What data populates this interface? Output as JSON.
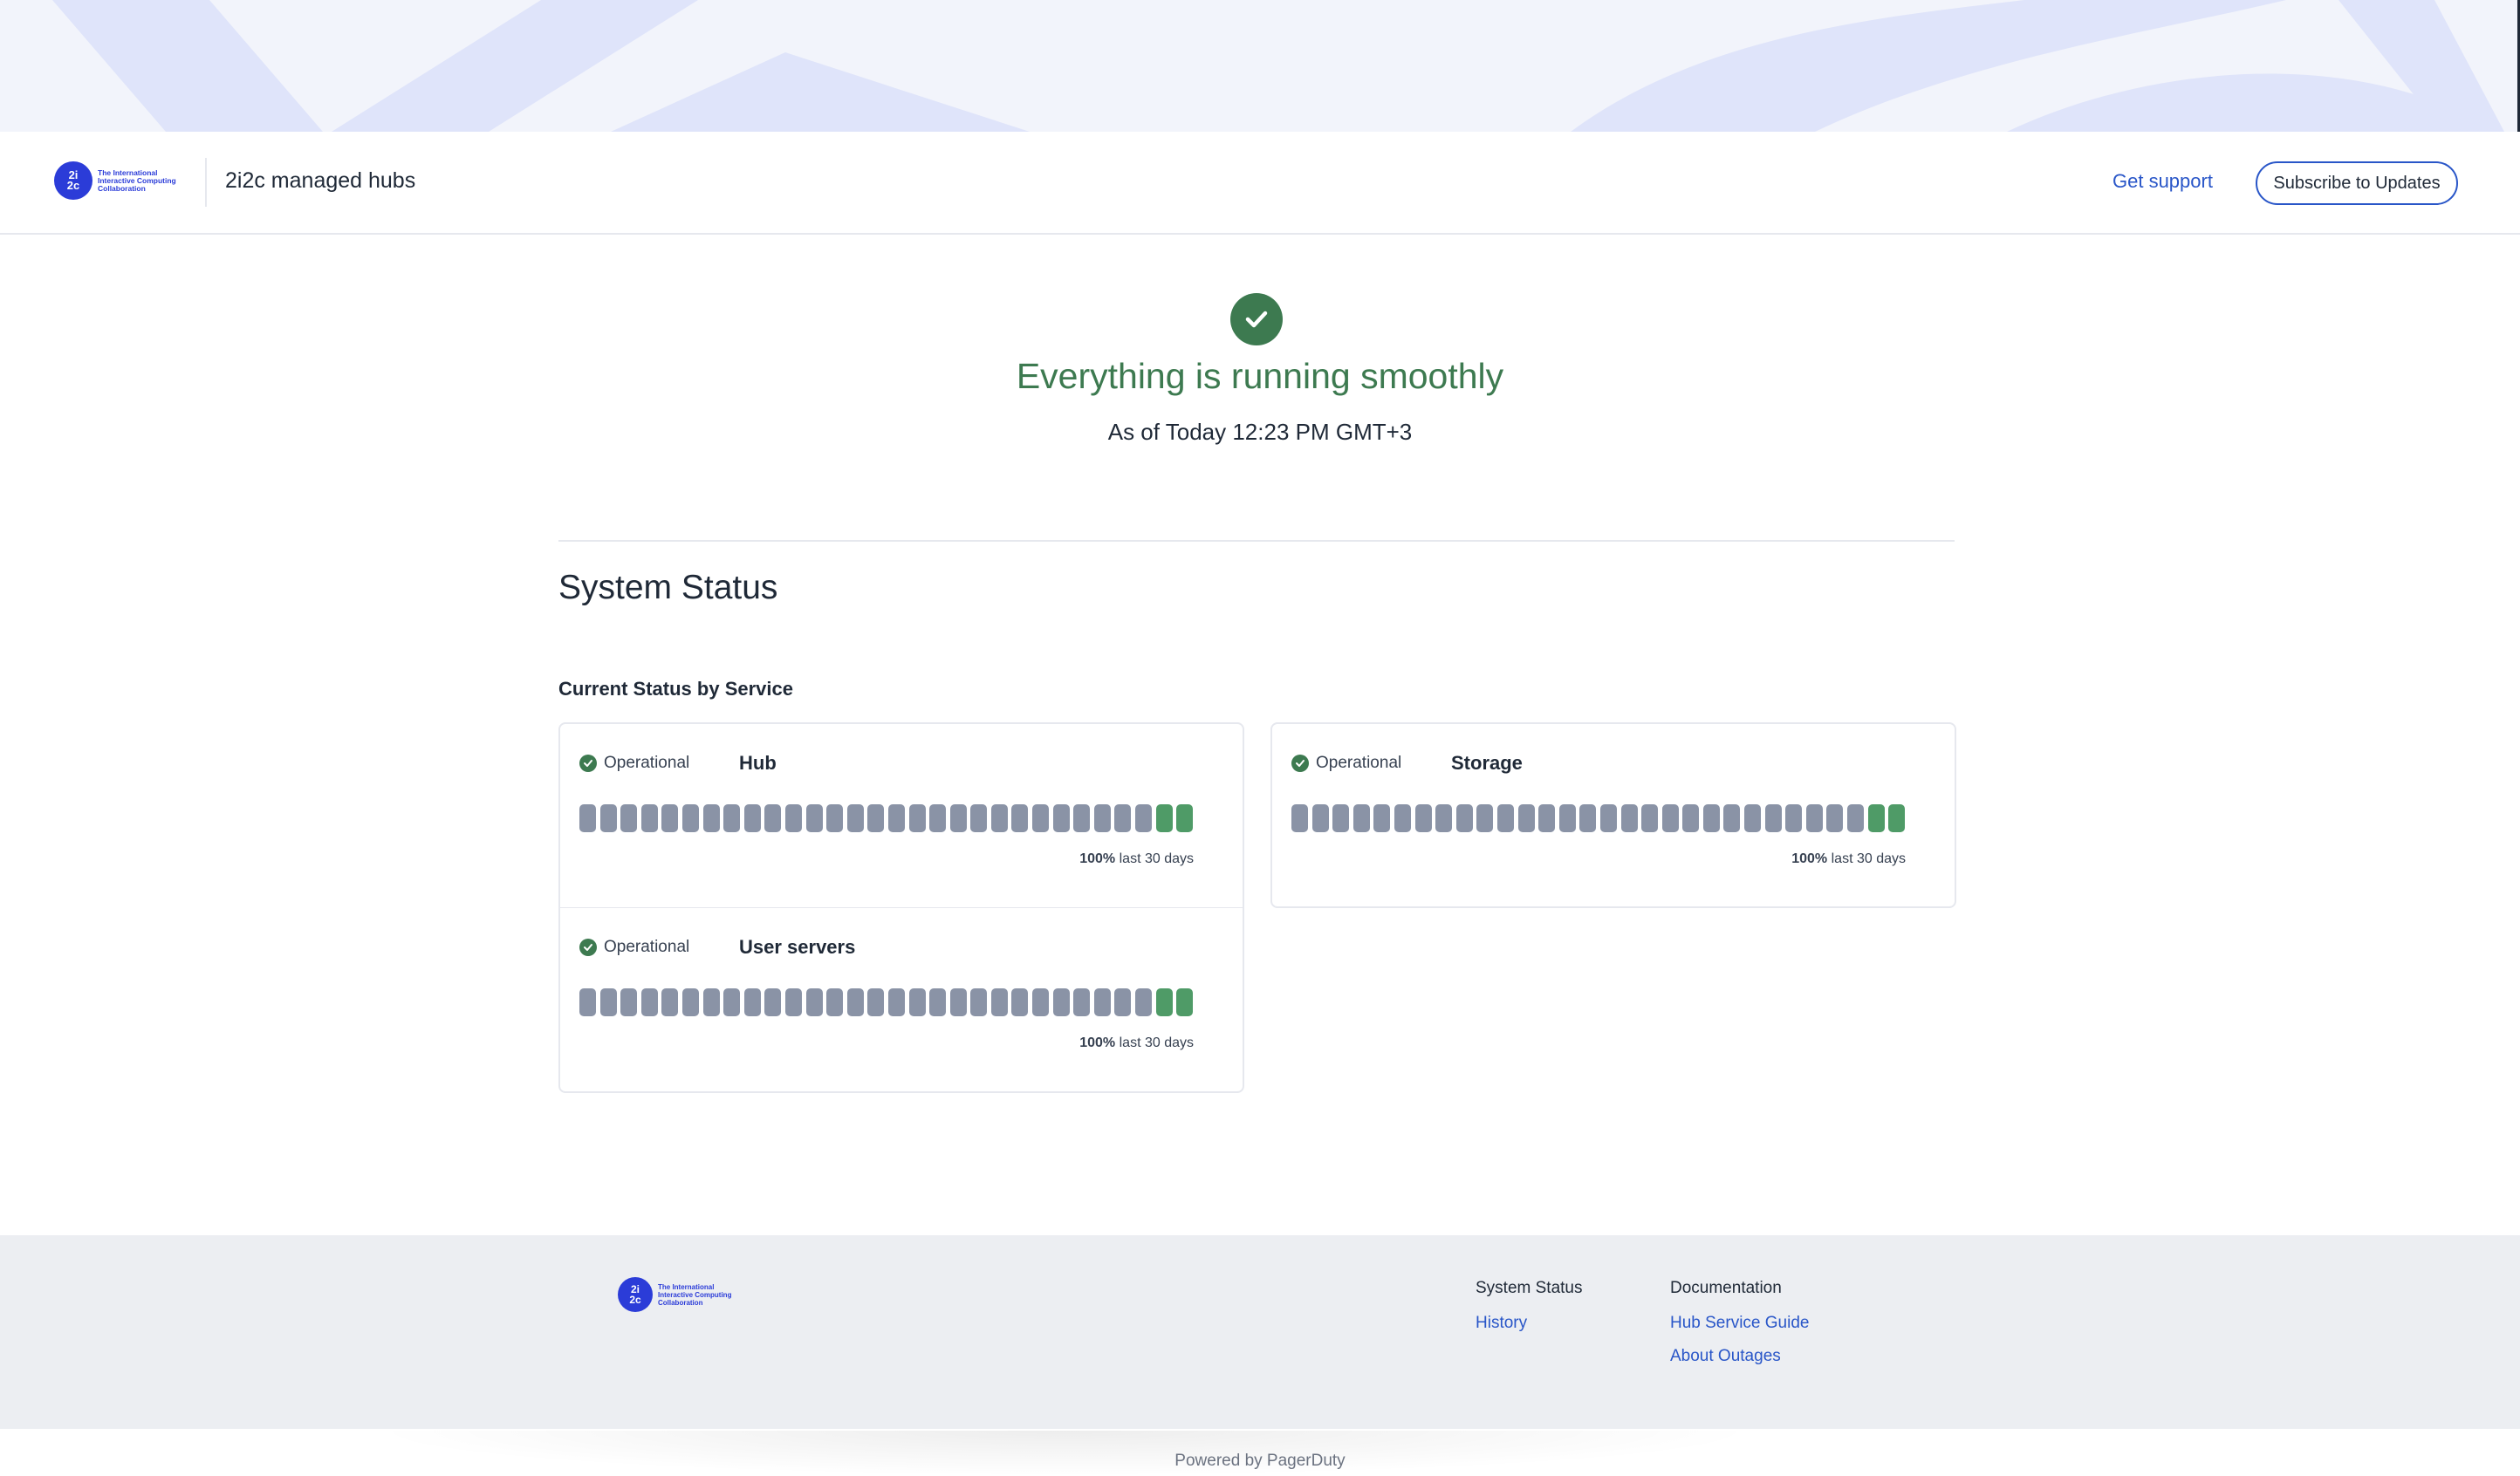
{
  "header": {
    "logo_mark": "2i2c",
    "logo_text": "The International Interactive Computing Collaboration",
    "title": "2i2c managed hubs",
    "get_support": "Get support",
    "subscribe": "Subscribe to Updates"
  },
  "banner": {
    "headline": "Everything is running smoothly",
    "as_of": "As of Today 12:23 PM GMT+3"
  },
  "main": {
    "section_title": "System Status",
    "subsection_title": "Current Status by Service",
    "services": [
      {
        "name": "Hub",
        "status": "Operational",
        "uptime": "100%",
        "period": "last 30 days",
        "bars_gray": 28,
        "bars_green": 2
      },
      {
        "name": "Storage",
        "status": "Operational",
        "uptime": "100%",
        "period": "last 30 days",
        "bars_gray": 28,
        "bars_green": 2
      },
      {
        "name": "User servers",
        "status": "Operational",
        "uptime": "100%",
        "period": "last 30 days",
        "bars_gray": 28,
        "bars_green": 2
      }
    ]
  },
  "footer": {
    "col1_title": "System Status",
    "col1_links": [
      "History"
    ],
    "col2_title": "Documentation",
    "col2_links": [
      "Hub Service Guide",
      "About Outages"
    ],
    "powered_by": "Powered by PagerDuty"
  },
  "colors": {
    "accent": "#2956c8",
    "brand": "#2b3cd8",
    "success": "#3d7a50",
    "bar_ok": "#4f9b67",
    "bar_nodata": "#8a93a6"
  }
}
